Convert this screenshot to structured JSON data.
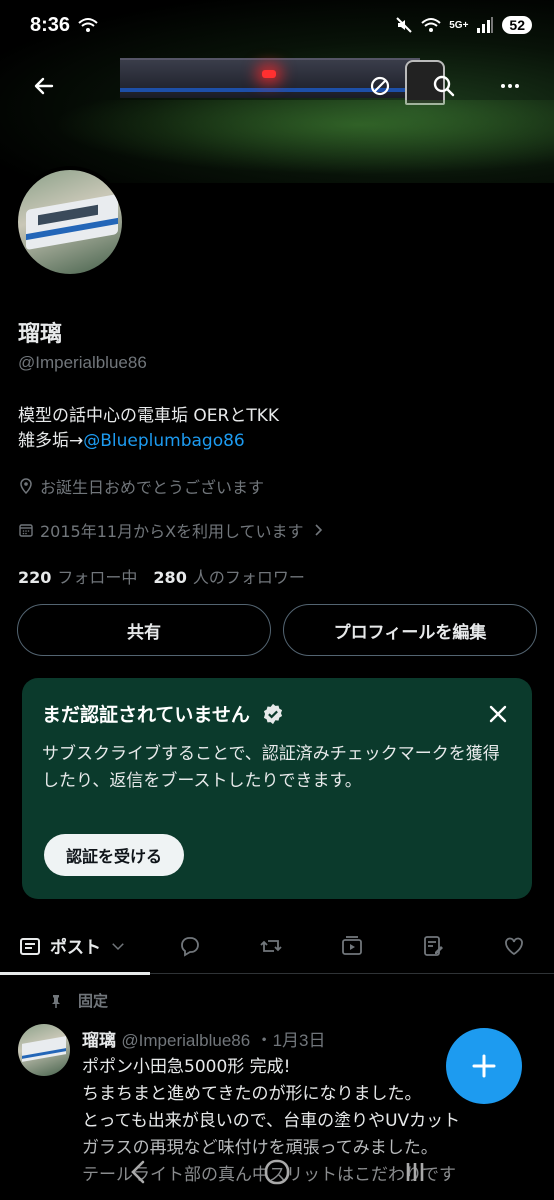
{
  "status_bar": {
    "time": "8:36",
    "network": "5G+",
    "battery": "52"
  },
  "header": {
    "back_icon": "arrow-left-icon",
    "icons": [
      "spam-icon",
      "search-icon",
      "more-icon"
    ]
  },
  "profile": {
    "display_name": "瑠璃",
    "handle": "@Imperialblue86",
    "bio_line1": "模型の話中心の電車垢 OERとTKK",
    "bio_line2_prefix": "雑多垢→",
    "bio_line2_link": "@Blueplumbago86",
    "location": "お誕生日おめでとうございます",
    "joined": "2015年11月からXを利用しています",
    "following_count": "220",
    "following_label": "フォロー中",
    "followers_count": "280",
    "followers_label": "人のフォロワー"
  },
  "actions": {
    "share_label": "共有",
    "edit_label": "プロフィールを編集"
  },
  "verify_card": {
    "title": "まだ認証されていません",
    "body": "サブスクライブすることで、認証済みチェックマークを獲得したり、返信をブーストしたりできます。",
    "button_label": "認証を受ける",
    "accent_color": "#0b3a2c"
  },
  "tabs": {
    "active_label": "ポスト",
    "icons": [
      "reply-icon",
      "repost-icon",
      "video-icon",
      "article-icon",
      "like-icon"
    ]
  },
  "pinned_label": "固定",
  "post": {
    "author": "瑠璃",
    "handle": "@Imperialblue86",
    "date": "・1月3日",
    "lines": [
      "ポポン小田急5000形 完成!",
      "ちまちまと進めてきたのが形になりました。",
      "とっても出来が良いので、台車の塗りやUVカット",
      "ガラスの再現など味付けを頑張ってみました。",
      "テールライト部の真ん中スリットはこだわりです"
    ]
  },
  "fab_icon": "plus-icon",
  "colors": {
    "accent": "#1d9bf0",
    "background": "#000000",
    "muted_text": "#71767b"
  }
}
